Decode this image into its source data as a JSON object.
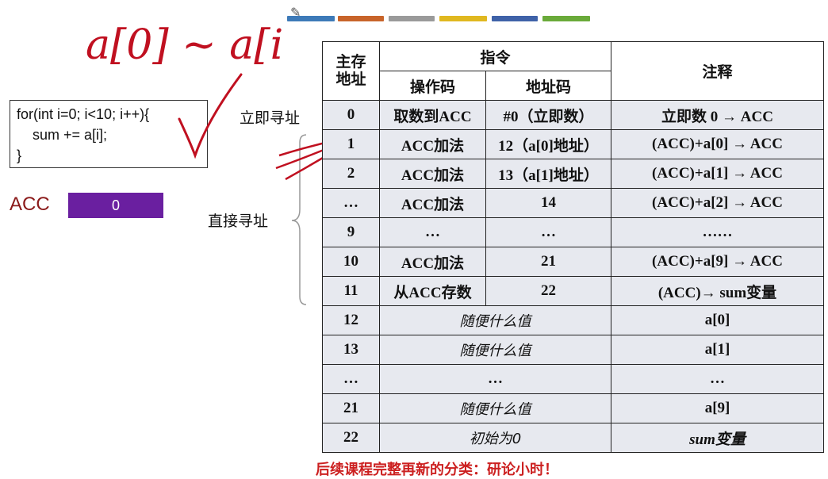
{
  "code_lines": [
    "for(int i=0; i<10; i++){",
    "    sum += a[i];",
    "}"
  ],
  "acc": {
    "label": "ACC",
    "value": "0"
  },
  "labels": {
    "immediate": "立即寻址",
    "direct": "直接寻址"
  },
  "handwriting": "a[0] ~ a[i",
  "table": {
    "header": {
      "addr": "主存\n地址",
      "instr": "指令",
      "opcode": "操作码",
      "addrcode": "地址码",
      "note": "注释"
    },
    "rows": [
      {
        "addr": "0",
        "op": "取数到ACC",
        "code": "#0（立即数）",
        "note": "立即数 0 → ACC"
      },
      {
        "addr": "1",
        "op": "ACC加法",
        "code": "12（a[0]地址）",
        "note": "(ACC)+a[0] → ACC"
      },
      {
        "addr": "2",
        "op": "ACC加法",
        "code": "13（a[1]地址）",
        "note": "(ACC)+a[1] → ACC"
      },
      {
        "addr": "…",
        "op": "ACC加法",
        "code": "14",
        "note": "(ACC)+a[2] → ACC"
      },
      {
        "addr": "9",
        "op": "…",
        "code": "…",
        "note": "……"
      },
      {
        "addr": "10",
        "op": "ACC加法",
        "code": "21",
        "note": "(ACC)+a[9] → ACC"
      },
      {
        "addr": "11",
        "op": "从ACC存数",
        "code": "22",
        "note": "(ACC)→ sum变量"
      }
    ],
    "data_rows": [
      {
        "addr": "12",
        "content": "随便什么值",
        "note": "a[0]"
      },
      {
        "addr": "13",
        "content": "随便什么值",
        "note": "a[1]"
      },
      {
        "addr": "…",
        "content": "…",
        "note": "…"
      },
      {
        "addr": "21",
        "content": "随便什么值",
        "note": "a[9]"
      },
      {
        "addr": "22",
        "content": "初始为0",
        "note": "sum变量"
      }
    ]
  },
  "bottom_text": "后续课程完整再新的分类：研论小时！",
  "colors": {
    "topbar": [
      "#3d7ab8",
      "#c8642a",
      "#9a9a9a",
      "#e0b820",
      "#3f62a8",
      "#6aaa3a"
    ],
    "opcode": "#b01a2e",
    "addrcode": "#b8901a",
    "acc_box": "#6a1fa0",
    "ink": "#c01020"
  }
}
